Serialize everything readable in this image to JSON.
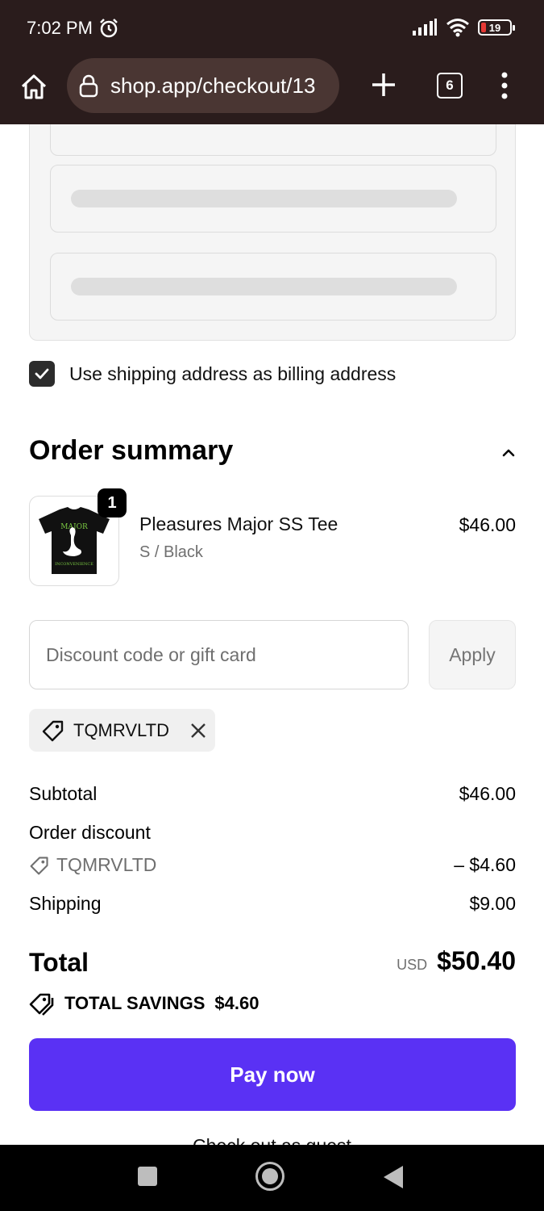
{
  "status_bar": {
    "time": "7:02 PM",
    "battery_level": "19",
    "icons": [
      "alarm-icon",
      "signal-icon",
      "wifi-icon",
      "battery-icon"
    ]
  },
  "browser": {
    "url": "shop.app/checkout/13",
    "tab_count": "6",
    "icons": [
      "home-icon",
      "lock-icon",
      "plus-icon",
      "tabs-icon",
      "more-vert-icon"
    ]
  },
  "billing": {
    "same_as_shipping_label": "Use shipping address as billing address",
    "same_as_shipping_checked": true
  },
  "order_summary": {
    "title": "Order summary",
    "item": {
      "quantity": "1",
      "name": "Pleasures Major SS Tee",
      "variant": "S / Black",
      "price": "$46.00",
      "thumb_text_top": "MAJOR",
      "thumb_text_bottom": "INCONVENIENCE"
    },
    "discount": {
      "placeholder": "Discount code or gift card",
      "value": "",
      "apply_label": "Apply",
      "applied_code": "TQMRVLTD"
    },
    "lines": {
      "subtotal_label": "Subtotal",
      "subtotal_value": "$46.00",
      "order_discount_label": "Order discount",
      "order_discount_code": "TQMRVLTD",
      "order_discount_value": "– $4.60",
      "shipping_label": "Shipping",
      "shipping_value": "$9.00"
    },
    "total": {
      "label": "Total",
      "currency": "USD",
      "amount": "$50.40"
    },
    "savings": {
      "label": "TOTAL SAVINGS",
      "amount": "$4.60"
    }
  },
  "actions": {
    "pay_label": "Pay now",
    "guest_label": "Check out as guest"
  },
  "colors": {
    "accent": "#5a31f4",
    "browser_bar": "#2a1c1c"
  }
}
